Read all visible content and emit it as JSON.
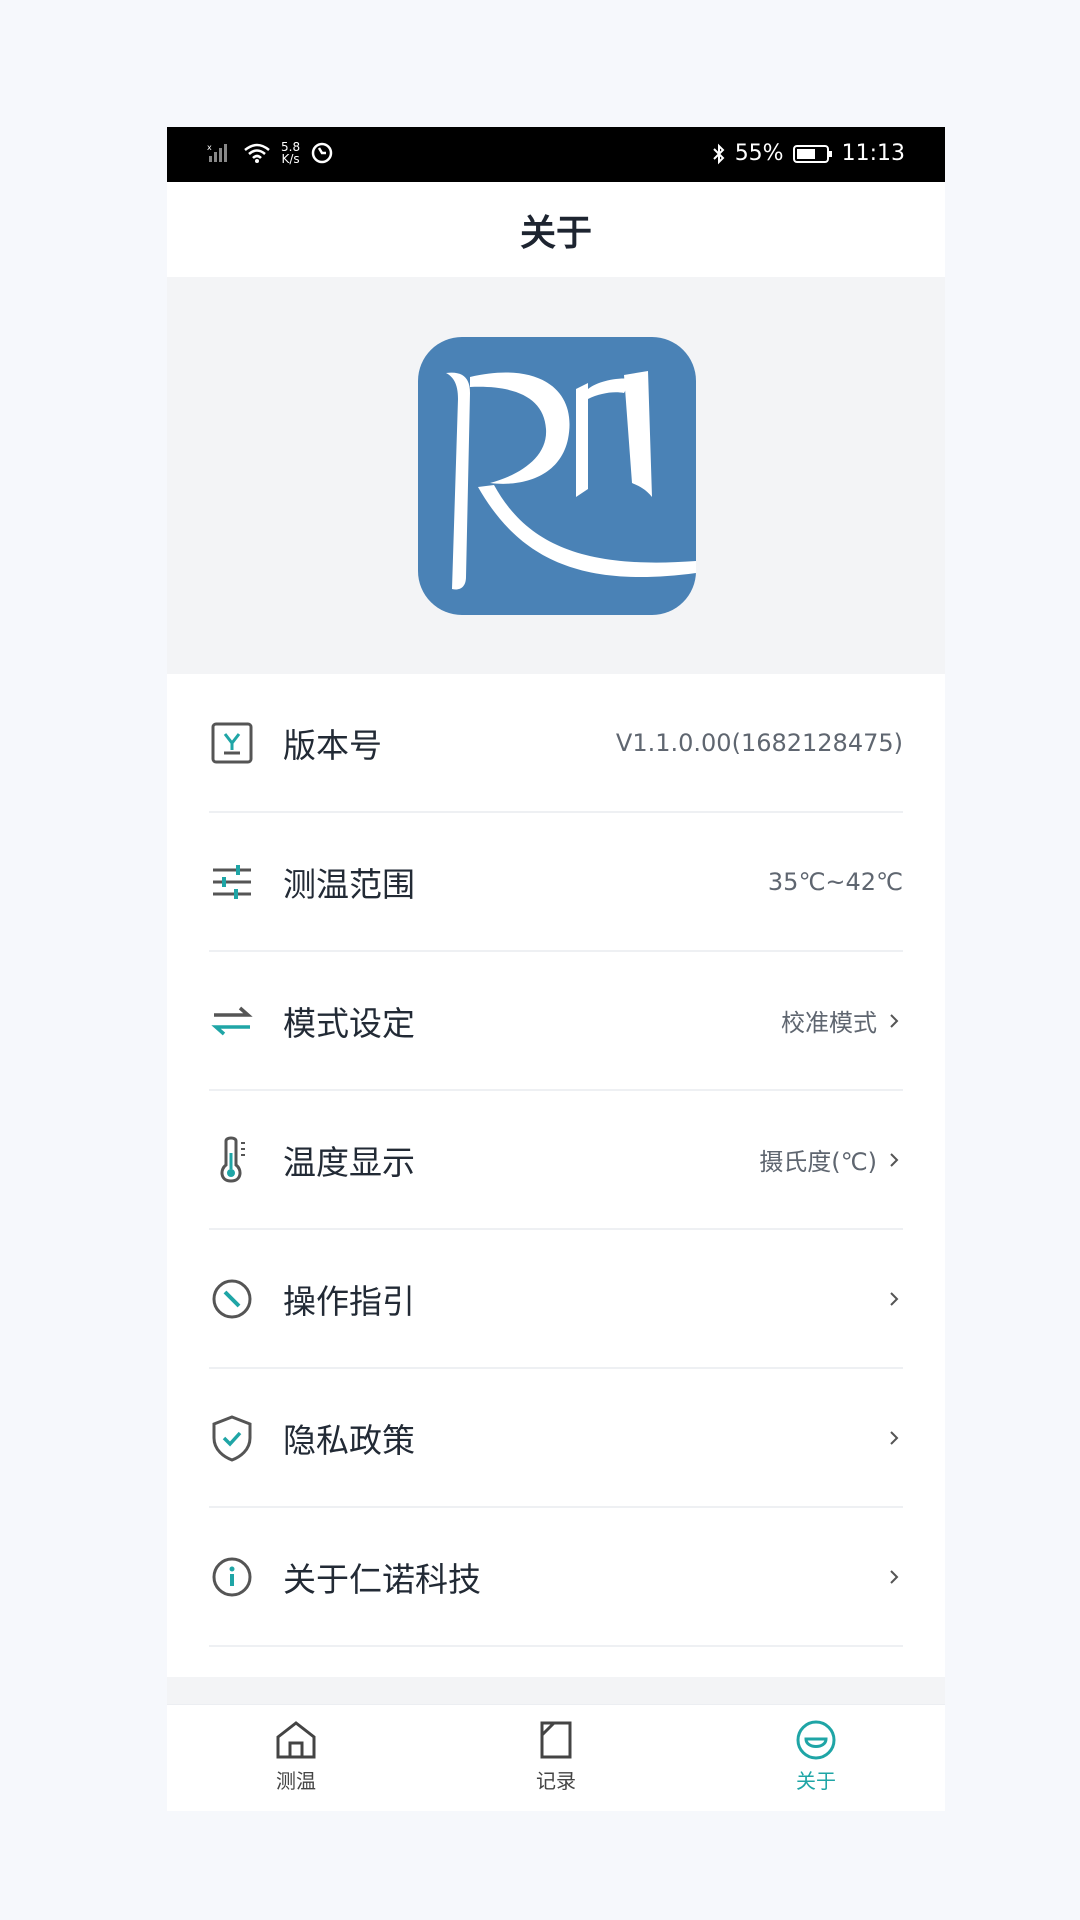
{
  "status_bar": {
    "speed_value": "5.8",
    "speed_unit": "K/s",
    "battery": "55%",
    "time": "11:13"
  },
  "header": {
    "title": "关于"
  },
  "app": {
    "logo_icon": "rn-logo-icon",
    "accent_color": "#4a82b6"
  },
  "settings": [
    {
      "label": "版本号",
      "value": "V1.1.0.00(1682128475)",
      "icon": "version-icon",
      "chevron": false
    },
    {
      "label": "测温范围",
      "value": "35℃~42℃",
      "icon": "sliders-icon",
      "chevron": false
    },
    {
      "label": "模式设定",
      "value": "校准模式",
      "icon": "swap-icon",
      "chevron": true
    },
    {
      "label": "温度显示",
      "value": "摄氏度(℃)",
      "icon": "thermometer-icon",
      "chevron": true
    },
    {
      "label": "操作指引",
      "value": "",
      "icon": "compass-icon",
      "chevron": true
    },
    {
      "label": "隐私政策",
      "value": "",
      "icon": "shield-icon",
      "chevron": true
    },
    {
      "label": "关于仁诺科技",
      "value": "",
      "icon": "info-icon",
      "chevron": true
    }
  ],
  "tabs": [
    {
      "label": "测温",
      "icon": "home-icon",
      "active": false
    },
    {
      "label": "记录",
      "icon": "record-icon",
      "active": false
    },
    {
      "label": "关于",
      "icon": "about-icon",
      "active": true
    }
  ],
  "colors": {
    "teal": "#1fa5a6",
    "text": "#222a35"
  }
}
